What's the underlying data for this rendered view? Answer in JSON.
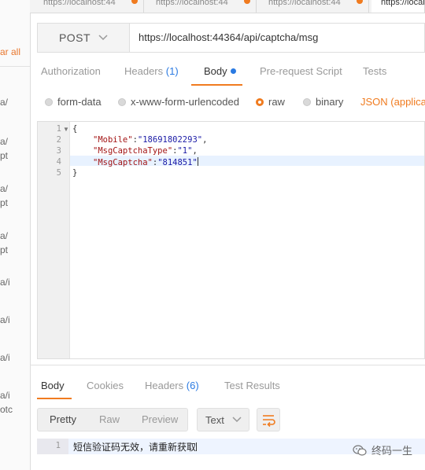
{
  "sidebar": {
    "clear_all": "ar all",
    "fragments": [
      "a/",
      "a/",
      "pt",
      "a/",
      "pt",
      "a/",
      "pt",
      "a/i",
      "a/i",
      "a/i",
      "a/i",
      "otc"
    ]
  },
  "tabs": [
    {
      "label": "https://localhost:44"
    },
    {
      "label": "https://localhost:44"
    },
    {
      "label": "https://localhost:44"
    },
    {
      "label": "https://locall"
    }
  ],
  "request": {
    "method": "POST",
    "url": "https://localhost:44364/api/captcha/msg"
  },
  "request_tabs": {
    "authorization": "Authorization",
    "headers": "Headers",
    "headers_count": "(1)",
    "body": "Body",
    "pre_request": "Pre-request Script",
    "tests": "Tests"
  },
  "body_types": {
    "form_data": "form-data",
    "urlencoded": "x-www-form-urlencoded",
    "raw": "raw",
    "binary": "binary",
    "selected": "raw",
    "format": "JSON (applicati"
  },
  "editor": {
    "line_numbers": [
      "1",
      "2",
      "3",
      "4",
      "5"
    ],
    "open_brace": "{",
    "close_brace": "}",
    "fields": [
      {
        "key": "\"Mobile\"",
        "value": "\"18691802293\""
      },
      {
        "key": "\"MsgCaptchaType\"",
        "value": "\"1\""
      },
      {
        "key": "\"MsgCaptcha\"",
        "value": "\"814851\""
      }
    ]
  },
  "response_tabs": {
    "body": "Body",
    "cookies": "Cookies",
    "headers": "Headers",
    "headers_count": "(6)",
    "test_results": "Test Results"
  },
  "response_view": {
    "pretty": "Pretty",
    "raw": "Raw",
    "preview": "Preview",
    "format": "Text"
  },
  "response_body": {
    "line": "1",
    "text": "短信验证码无效，请重新获取"
  },
  "watermark": "终码一生",
  "colors": {
    "accent": "#f07b1f",
    "link_blue": "#2a7ae2",
    "json_key": "#a31515",
    "json_string": "#1a1aa6"
  }
}
